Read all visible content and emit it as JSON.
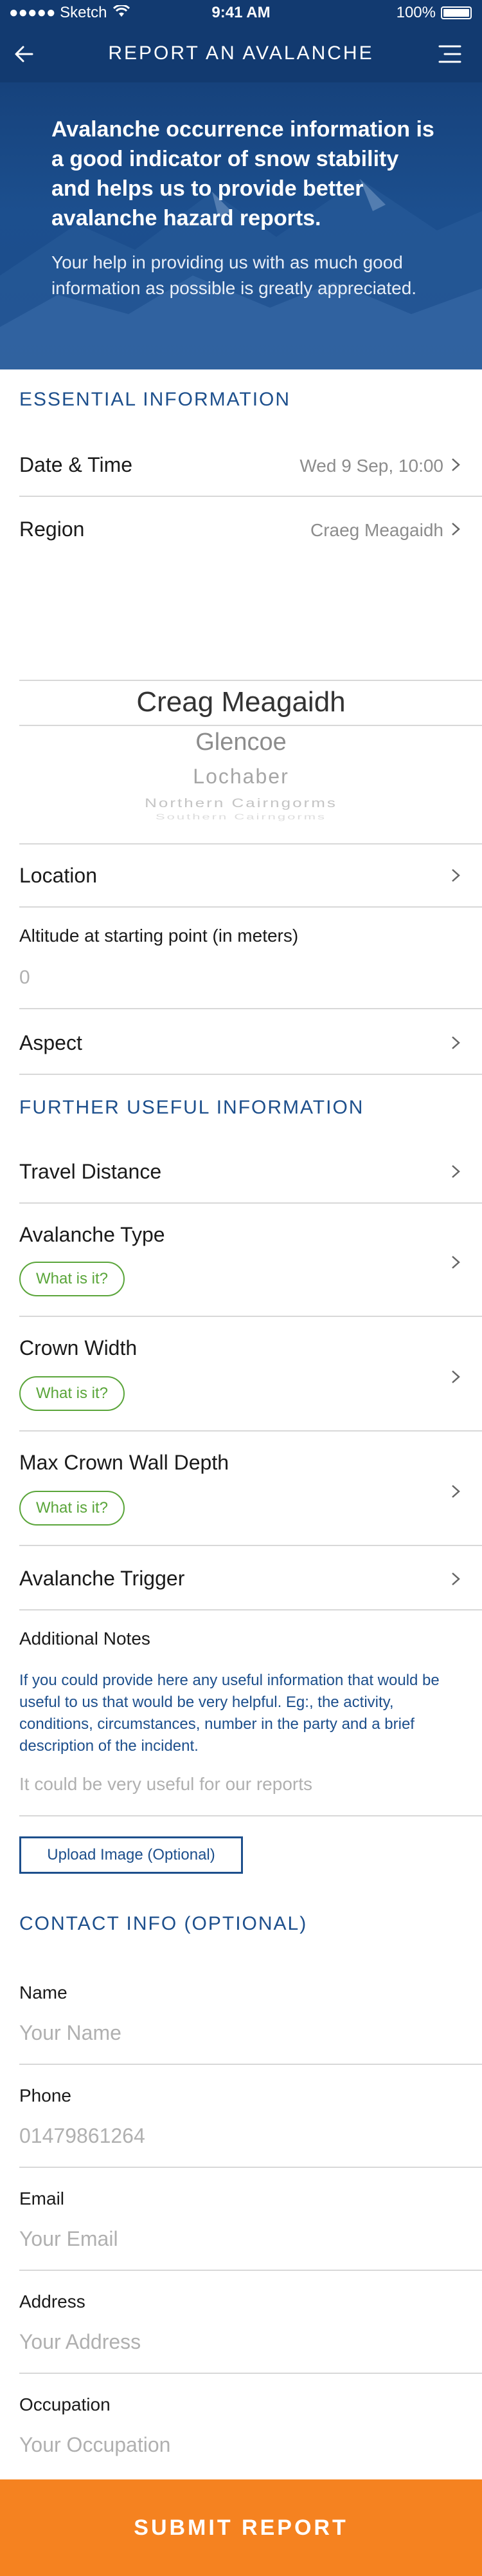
{
  "status_bar": {
    "carrier": "●●●●● Sketch",
    "time": "9:41 AM",
    "battery": "100%"
  },
  "nav": {
    "title": "REPORT AN AVALANCHE"
  },
  "hero": {
    "headline": "Avalanche occurrence information is a good indicator of snow stability and helps us to provide better avalanche hazard reports.",
    "subtext": "Your help in providing us with as much good information as possible is greatly appreciated."
  },
  "essential": {
    "title": "ESSENTIAL INFORMATION",
    "date_time": {
      "label": "Date & Time",
      "value": "Wed 9 Sep, 10:00"
    },
    "region": {
      "label": "Region",
      "value": "Craeg Meagaidh"
    },
    "picker": {
      "options": [
        "Creag Meagaidh",
        "Glencoe",
        "Lochaber",
        "Northern Cairngorms",
        "Southern Cairngorms"
      ],
      "selected": "Creag Meagaidh"
    },
    "location": {
      "label": "Location"
    },
    "altitude": {
      "label": "Altitude at starting point (in meters)",
      "value": "0"
    },
    "aspect": {
      "label": "Aspect"
    }
  },
  "further": {
    "title": "FURTHER USEFUL INFORMATION",
    "travel_distance": {
      "label": "Travel Distance"
    },
    "avalanche_type": {
      "label": "Avalanche Type",
      "help": "What is it?"
    },
    "crown_width": {
      "label": "Crown Width",
      "help": "What is it?"
    },
    "max_crown_wall_depth": {
      "label": "Max Crown Wall Depth",
      "help": "What is it?"
    },
    "avalanche_trigger": {
      "label": "Avalanche Trigger"
    },
    "notes": {
      "label": "Additional Notes",
      "description": "If you could provide here any useful information that would be useful to us that would be very helpful. Eg:, the activity, conditions, circumstances, number in the party and a brief description of the incident.",
      "placeholder": "It could be very useful for our reports"
    },
    "upload_label": "Upload Image (Optional)"
  },
  "contact": {
    "title": "CONTACT INFO (OPTIONAL)",
    "name": {
      "label": "Name",
      "placeholder": "Your Name"
    },
    "phone": {
      "label": "Phone",
      "placeholder": "01479861264"
    },
    "email": {
      "label": "Email",
      "placeholder": "Your Email"
    },
    "address": {
      "label": "Address",
      "placeholder": "Your Address"
    },
    "occupation": {
      "label": "Occupation",
      "placeholder": "Your Occupation"
    }
  },
  "submit_label": "SUBMIT REPORT",
  "colors": {
    "nav_blue": "#123a70",
    "accent_blue": "#1d4f8c",
    "help_green": "#5aa53a",
    "submit_orange": "#f58220"
  },
  "icons": {
    "back": "back-arrow-icon",
    "menu": "hamburger-menu-icon",
    "row_disclosure": "chevron-right-icon",
    "wifi": "wifi-icon",
    "battery": "battery-icon"
  }
}
